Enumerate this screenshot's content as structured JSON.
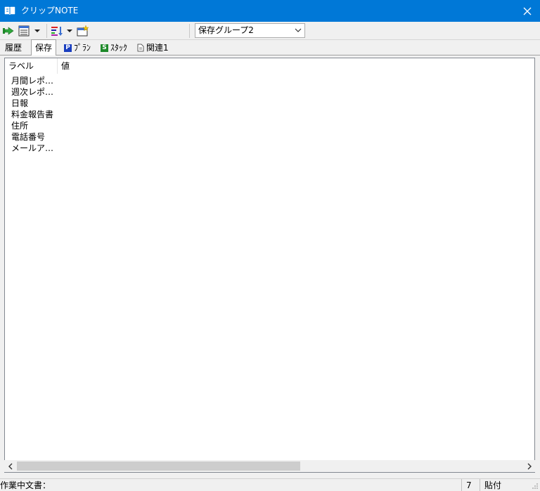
{
  "window": {
    "title": "クリップNOTE",
    "close_glyph": "✕"
  },
  "toolbar": {
    "group_combo_value": "保存グループ2"
  },
  "tabs": [
    {
      "label": "履歴",
      "active": false
    },
    {
      "label": "保存",
      "active": true
    },
    {
      "label": "ﾌﾟﾗﾝ",
      "active": false,
      "badge": "P",
      "badge_color": "#1a3fbf"
    },
    {
      "label": "ｽﾀｯｸ",
      "active": false,
      "badge": "S",
      "badge_color": "#1e8a2a"
    },
    {
      "label": "関連1",
      "active": false
    }
  ],
  "list": {
    "columns": [
      "ラベル",
      "値"
    ],
    "rows": [
      {
        "label": "月間レポート"
      },
      {
        "label": "週次レポート"
      },
      {
        "label": "日報"
      },
      {
        "label": "料金報告書"
      },
      {
        "label": "住所"
      },
      {
        "label": "電話番号"
      },
      {
        "label": "メールアドレス"
      }
    ]
  },
  "statusbar": {
    "text": "作業中文書：",
    "count": "7",
    "mode": "貼付"
  },
  "colors": {
    "titlebar": "#0078d7",
    "badge_plan": "#1a3fbf",
    "badge_stack": "#1e8a2a"
  }
}
